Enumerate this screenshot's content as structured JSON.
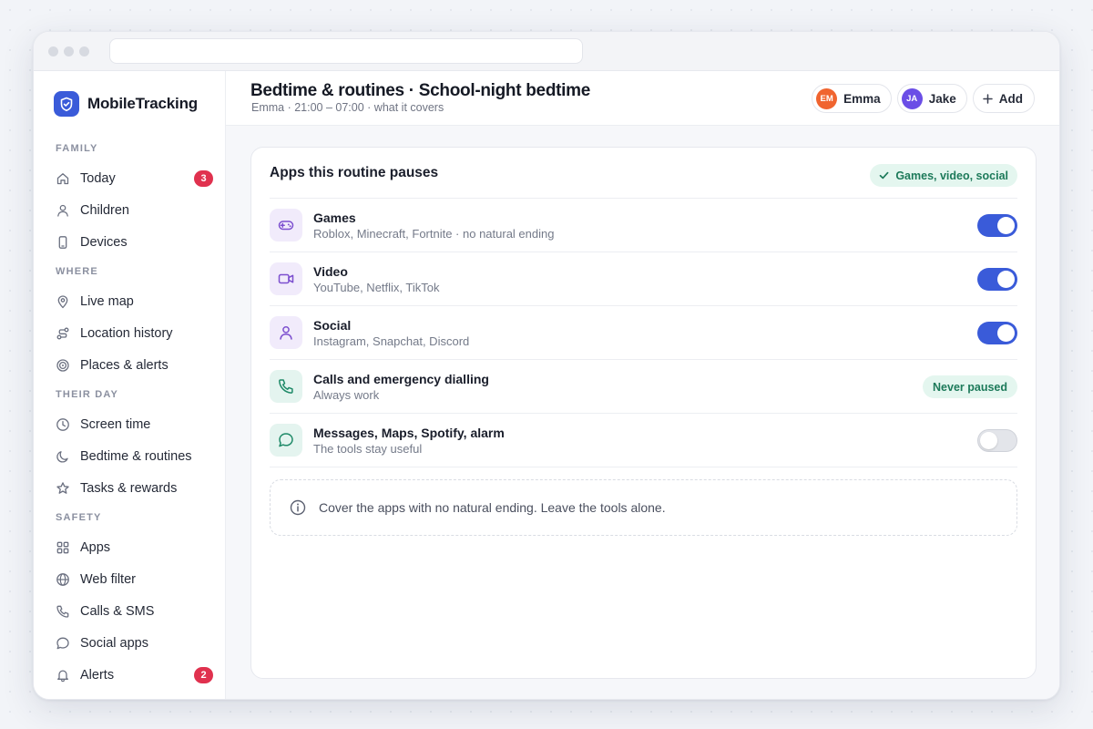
{
  "app": {
    "brand": "MobileTracking",
    "accent": "#3a5bd9"
  },
  "sidebar": {
    "sections": [
      {
        "title": "FAMILY",
        "items": [
          {
            "label": "Today",
            "icon": "home-icon",
            "badge": "3"
          },
          {
            "label": "Children",
            "icon": "person-icon"
          },
          {
            "label": "Devices",
            "icon": "phone-icon"
          }
        ]
      },
      {
        "title": "WHERE",
        "items": [
          {
            "label": "Live map",
            "icon": "map-pin-icon"
          },
          {
            "label": "Location history",
            "icon": "route-icon"
          },
          {
            "label": "Places & alerts",
            "icon": "target-icon"
          }
        ]
      },
      {
        "title": "THEIR DAY",
        "items": [
          {
            "label": "Screen time",
            "icon": "clock-icon"
          },
          {
            "label": "Bedtime & routines",
            "icon": "moon-icon"
          },
          {
            "label": "Tasks & rewards",
            "icon": "star-icon"
          }
        ]
      },
      {
        "title": "SAFETY",
        "items": [
          {
            "label": "Apps",
            "icon": "grid-icon"
          },
          {
            "label": "Web filter",
            "icon": "globe-icon"
          },
          {
            "label": "Calls & SMS",
            "icon": "phone-call-icon"
          },
          {
            "label": "Social apps",
            "icon": "chat-bubble-icon"
          },
          {
            "label": "Alerts",
            "icon": "bell-icon",
            "badge": "2"
          }
        ]
      }
    ]
  },
  "header": {
    "title": "Bedtime & routines · School-night bedtime",
    "subtitle": "Emma · 21:00 – 07:00 · what it covers",
    "children": [
      {
        "initials": "EM",
        "name": "Emma",
        "color": "#f0642f"
      },
      {
        "initials": "JA",
        "name": "Jake",
        "color": "#6b4ee6"
      }
    ],
    "add_label": "Add"
  },
  "card": {
    "title": "Apps this routine pauses",
    "summary": "Games, video, social",
    "rows": [
      {
        "title": "Games",
        "desc": "Roblox, Minecraft, Fortnite · no natural ending",
        "icon": "gamepad-icon",
        "state": "on"
      },
      {
        "title": "Video",
        "desc": "YouTube, Netflix, TikTok",
        "icon": "video-camera-icon",
        "state": "on"
      },
      {
        "title": "Social",
        "desc": "Instagram, Snapchat, Discord",
        "icon": "person-icon",
        "state": "on"
      },
      {
        "title": "Calls and emergency dialling",
        "desc": "Always work",
        "icon": "phone-call-icon",
        "state": "fixed",
        "pill": "Never paused"
      },
      {
        "title": "Messages, Maps, Spotify, alarm",
        "desc": "The tools stay useful",
        "icon": "chat-bubble-icon",
        "state": "off"
      }
    ],
    "tip": "Cover the apps with no natural ending. Leave the tools alone."
  }
}
